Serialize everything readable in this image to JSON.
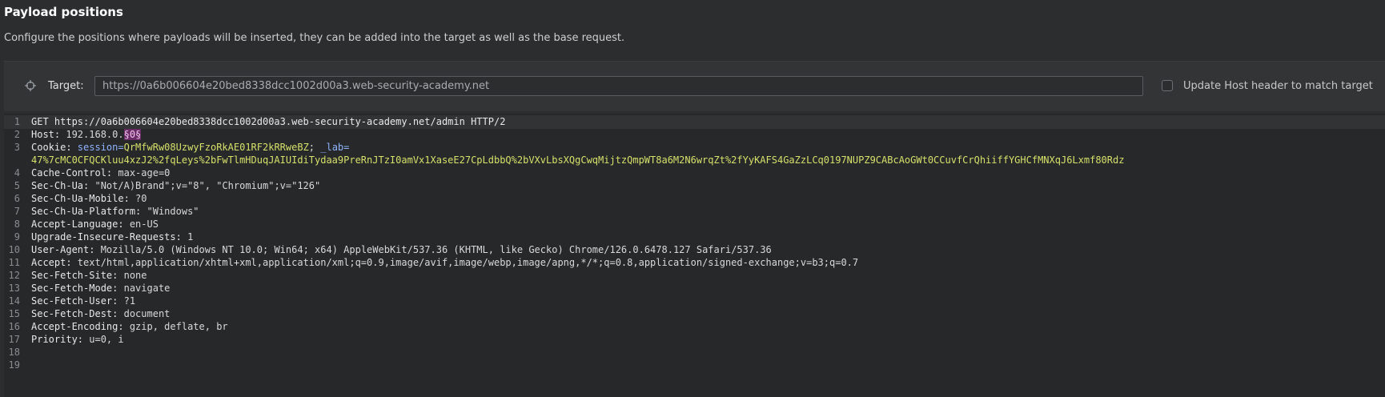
{
  "header": {
    "title": "Payload positions",
    "description": "Configure the positions where payloads will be inserted, they can be added into the target as well as the base request."
  },
  "target": {
    "label": "Target:",
    "value": "https://0a6b006604e20bed8338dcc1002d00a3.web-security-academy.net",
    "update_host_label": "Update Host header to match target",
    "update_host_checked": false
  },
  "request": {
    "lines": [
      {
        "num": "1",
        "text": "GET https://0a6b006604e20bed8338dcc1002d00a3.web-security-academy.net/admin HTTP/2"
      },
      {
        "num": "2",
        "name": "Host:",
        "value": " 192.168.0.",
        "marker": "§0§"
      },
      {
        "num": "3",
        "name": "Cookie:",
        "cookie_name1": " session=",
        "cookie_val1": "QrMfwRw08UzwyFzoRkAE01RF2kRRweBZ",
        "sep": "; ",
        "cookie_name2": "_lab="
      },
      {
        "num": "",
        "cookie_val2": "47%7cMC0CFQCKluu4xzJ2%2fqLeys%2bFwTlmHDuqJAIUIdiTydaa9PreRnJTzI0amVx1XaseE27CpLdbbQ%2bVXvLbsXQgCwqMijtzQmpWT8a6M2N6wrqZt%2fYyKAFS4GaZzLCq0197NUPZ9CABcAoGWt0CCuvfCrQhiiffYGHCfMNXqJ6Lxmf80Rdz"
      },
      {
        "num": "4",
        "name": "Cache-Control:",
        "value": " max-age=0"
      },
      {
        "num": "5",
        "name": "Sec-Ch-Ua:",
        "value": " \"Not/A)Brand\";v=\"8\", \"Chromium\";v=\"126\""
      },
      {
        "num": "6",
        "name": "Sec-Ch-Ua-Mobile:",
        "value": " ?0"
      },
      {
        "num": "7",
        "name": "Sec-Ch-Ua-Platform:",
        "value": " \"Windows\""
      },
      {
        "num": "8",
        "name": "Accept-Language:",
        "value": " en-US"
      },
      {
        "num": "9",
        "name": "Upgrade-Insecure-Requests:",
        "value": " 1"
      },
      {
        "num": "10",
        "name": "User-Agent:",
        "value": " Mozilla/5.0 (Windows NT 10.0; Win64; x64) AppleWebKit/537.36 (KHTML, like Gecko) Chrome/126.0.6478.127 Safari/537.36"
      },
      {
        "num": "11",
        "name": "Accept:",
        "value": " text/html,application/xhtml+xml,application/xml;q=0.9,image/avif,image/webp,image/apng,*/*;q=0.8,application/signed-exchange;v=b3;q=0.7"
      },
      {
        "num": "12",
        "name": "Sec-Fetch-Site:",
        "value": " none"
      },
      {
        "num": "13",
        "name": "Sec-Fetch-Mode:",
        "value": " navigate"
      },
      {
        "num": "14",
        "name": "Sec-Fetch-User:",
        "value": " ?1"
      },
      {
        "num": "15",
        "name": "Sec-Fetch-Dest:",
        "value": " document"
      },
      {
        "num": "16",
        "name": "Accept-Encoding:",
        "value": " gzip, deflate, br"
      },
      {
        "num": "17",
        "name": "Priority:",
        "value": " u=0, i"
      },
      {
        "num": "18"
      },
      {
        "num": "19"
      }
    ]
  },
  "colors": {
    "background": "#2b2d2f",
    "editor_background": "#262829",
    "cookie_name": "#8fb4ff",
    "cookie_value": "#d7e06a",
    "payload_marker": "#6a2a66"
  },
  "icons": {
    "target": "crosshair-icon"
  }
}
